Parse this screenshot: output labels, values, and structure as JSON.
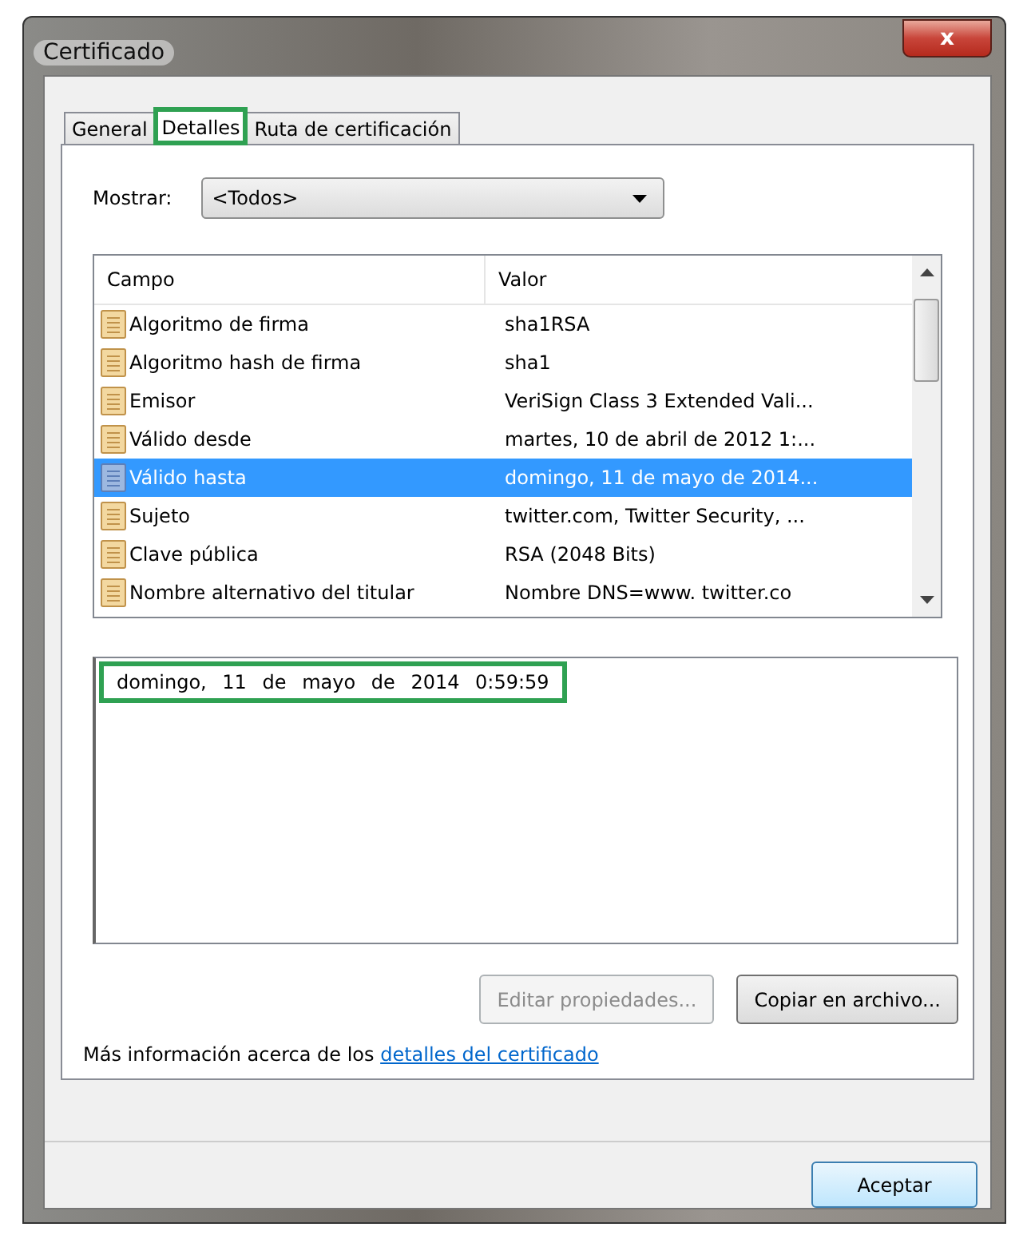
{
  "window": {
    "title": "Certificado",
    "close": "x"
  },
  "tabs": [
    {
      "label": "General",
      "selected": false,
      "highlighted": false
    },
    {
      "label": "Detalles",
      "selected": true,
      "highlighted": true
    },
    {
      "label": "Ruta de certificación",
      "selected": false,
      "highlighted": false
    }
  ],
  "show": {
    "label": "Mostrar:",
    "value": "<Todos>"
  },
  "table": {
    "columns": [
      "Campo",
      "Valor"
    ],
    "rows": [
      {
        "field": "Algoritmo de firma",
        "value": "sha1RSA",
        "selected": false
      },
      {
        "field": "Algoritmo hash de firma",
        "value": "sha1",
        "selected": false
      },
      {
        "field": "Emisor",
        "value": "VeriSign Class 3 Extended Vali...",
        "selected": false
      },
      {
        "field": "Válido desde",
        "value": "martes, 10 de abril de 2012 1:...",
        "selected": false
      },
      {
        "field": "Válido hasta",
        "value": "domingo, 11 de mayo de 2014...",
        "selected": true
      },
      {
        "field": "Sujeto",
        "value": "twitter.com, Twitter Security, ...",
        "selected": false
      },
      {
        "field": "Clave pública",
        "value": "RSA (2048 Bits)",
        "selected": false
      },
      {
        "field": "Nombre alternativo del titular",
        "value": "Nombre DNS=www. twitter.co",
        "selected": false
      }
    ]
  },
  "detail": {
    "text": "domingo, 11 de mayo de 2014 0:59:59",
    "highlighted": true
  },
  "buttons": [
    {
      "label": "Editar propiedades...",
      "disabled": true
    },
    {
      "label": "Copiar en archivo...",
      "disabled": false
    }
  ],
  "info": {
    "text": "Más información acerca de los",
    "link": "detalles del certificado"
  },
  "ok": "Aceptar"
}
